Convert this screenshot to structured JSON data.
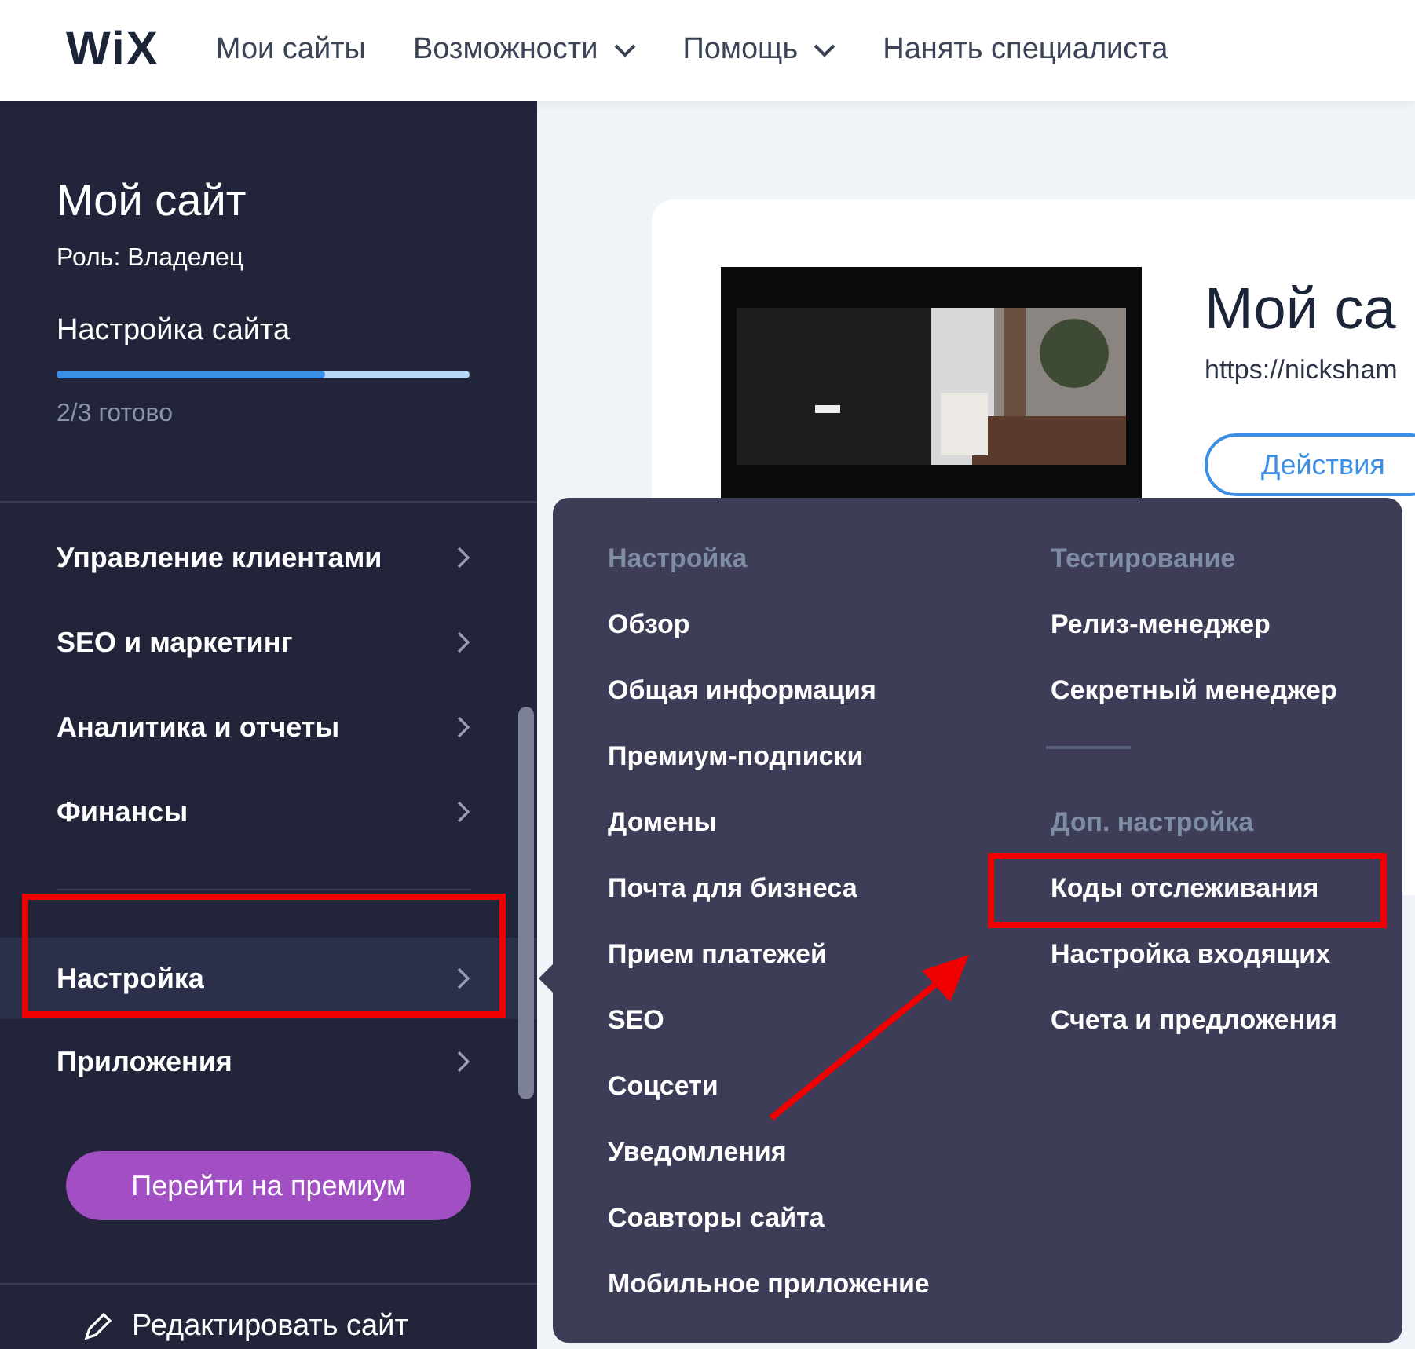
{
  "top_nav": {
    "logo": "WiX",
    "items": [
      {
        "label": "Мои сайты",
        "dropdown": false
      },
      {
        "label": "Возможности",
        "dropdown": true
      },
      {
        "label": "Помощь",
        "dropdown": true
      },
      {
        "label": "Нанять специалиста",
        "dropdown": false
      }
    ]
  },
  "sidebar": {
    "site_name": "Мой сайт",
    "role": "Роль: Владелец",
    "setup": {
      "label": "Настройка сайта",
      "level": 0.65,
      "status": "2/3 готово"
    },
    "groups": [
      [
        {
          "label": "Управление клиентами",
          "selected": false
        },
        {
          "label": "SEO и маркетинг",
          "selected": false
        },
        {
          "label": "Аналитика и отчеты",
          "selected": false
        },
        {
          "label": "Финансы",
          "selected": false
        }
      ],
      [
        {
          "label": "Настройка",
          "selected": true
        },
        {
          "label": "Приложения",
          "selected": false
        }
      ]
    ],
    "premium_button": "Перейти на премиум",
    "edit_site": "Редактировать сайт"
  },
  "site_card": {
    "title": "Мой са",
    "url": "https://nicksham",
    "actions_button": "Действия"
  },
  "submenu": {
    "columns": [
      [
        {
          "heading": "Настройка",
          "items": [
            "Обзор",
            "Общая информация",
            "Премиум-подписки",
            "Домены",
            "Почта для бизнеса",
            "Прием платежей",
            "SEO",
            "Соцсети",
            "Уведомления",
            "Соавторы сайта",
            "Мобильное приложение"
          ]
        }
      ],
      [
        {
          "heading": "Тестирование",
          "items": [
            "Релиз-менеджер",
            "Секретный менеджер"
          ]
        },
        {
          "heading": "Доп. настройка",
          "items": [
            "Коды отслеживания",
            "Настройка входящих",
            "Счета и предложения"
          ]
        }
      ]
    ]
  }
}
